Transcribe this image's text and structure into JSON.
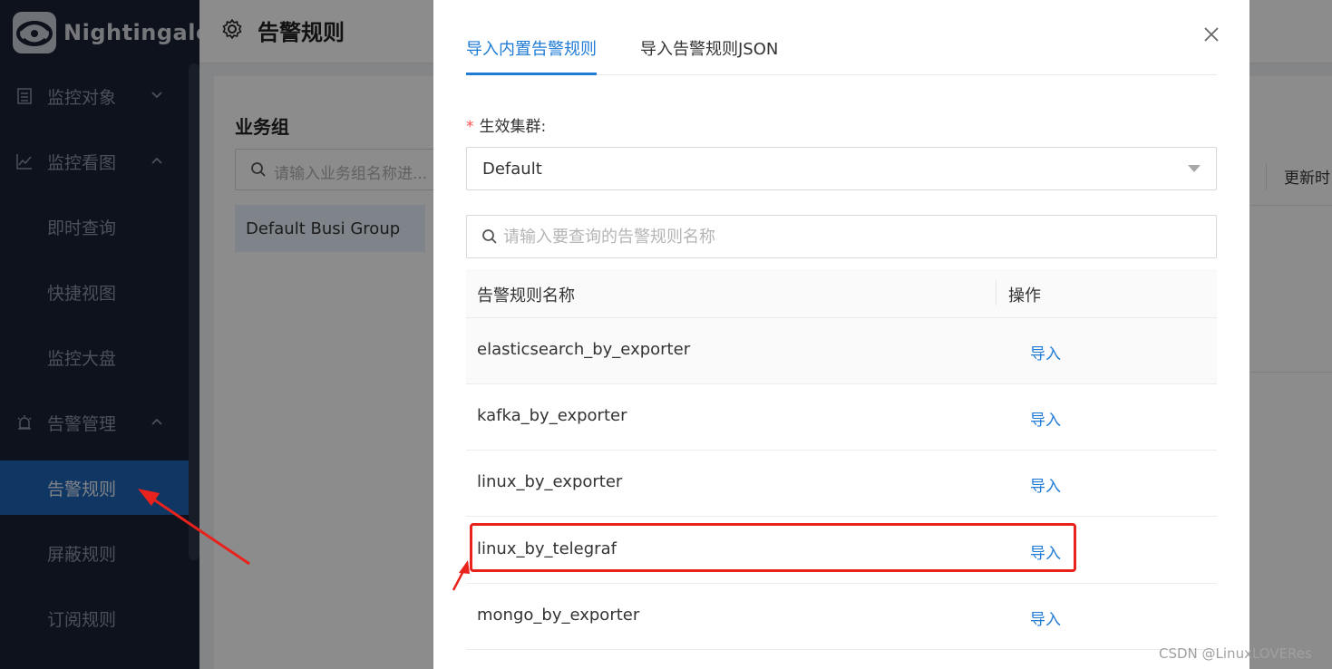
{
  "app": {
    "name": "Nightingale"
  },
  "sidebar": {
    "items": [
      {
        "label": "监控对象",
        "icon": "list-icon",
        "expanded": false
      },
      {
        "label": "监控看图",
        "icon": "chart-line-icon",
        "expanded": true
      },
      {
        "label": "即时查询"
      },
      {
        "label": "快捷视图"
      },
      {
        "label": "监控大盘"
      },
      {
        "label": "告警管理",
        "icon": "alarm-icon",
        "expanded": true
      },
      {
        "label": "告警规则",
        "active": true
      },
      {
        "label": "屏蔽规则"
      },
      {
        "label": "订阅规则"
      }
    ]
  },
  "header": {
    "title": "告警规则"
  },
  "background": {
    "group_label": "业务组",
    "group_search_placeholder": "请输入业务组名称进...",
    "group_item": "Default Busi Group",
    "update_time_label": "更新时"
  },
  "modal": {
    "tabs": [
      {
        "label": "导入内置告警规则",
        "active": true
      },
      {
        "label": "导入告警规则JSON",
        "active": false
      }
    ],
    "cluster_label": "生效集群:",
    "cluster_value": "Default",
    "search_placeholder": "请输入要查询的告警规则名称",
    "table": {
      "columns": [
        "告警规则名称",
        "操作"
      ],
      "rows": [
        {
          "name": "elasticsearch_by_exporter",
          "action": "导入"
        },
        {
          "name": "kafka_by_exporter",
          "action": "导入"
        },
        {
          "name": "linux_by_exporter",
          "action": "导入"
        },
        {
          "name": "linux_by_telegraf",
          "action": "导入",
          "highlighted": true
        },
        {
          "name": "mongo_by_exporter",
          "action": "导入"
        }
      ]
    }
  },
  "watermark": "CSDN @LinuxLOVERes",
  "colors": {
    "accent": "#1f7bd6",
    "sidebar_bg": "#1b2233",
    "active_bg": "#1e64b4",
    "annotation_red": "#e8221c"
  }
}
